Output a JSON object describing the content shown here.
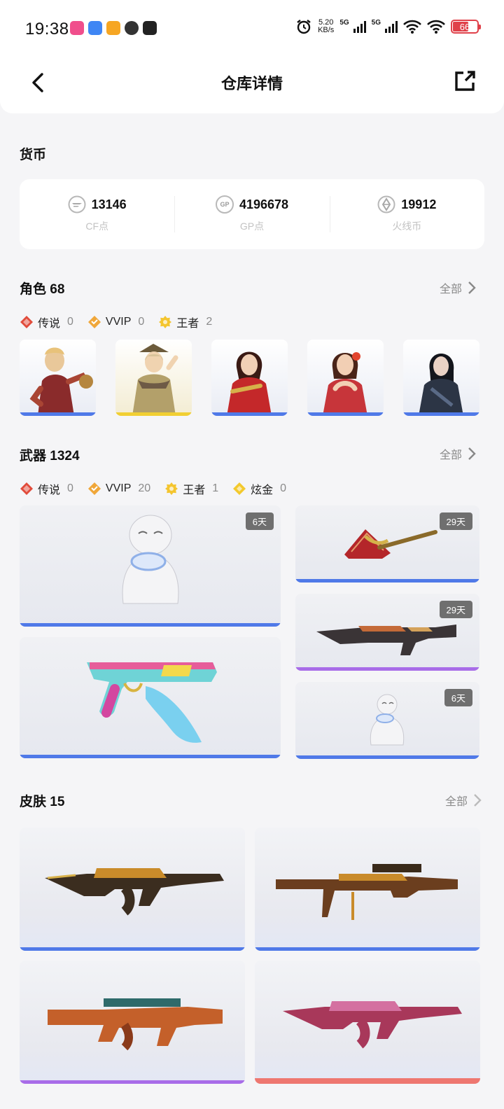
{
  "status": {
    "time": "19:38",
    "speed_value": "5.20",
    "speed_unit": "KB/s",
    "net1": "5G",
    "net2": "5G",
    "battery": "66"
  },
  "nav": {
    "title": "仓库详情"
  },
  "currency": {
    "title": "货币",
    "items": [
      {
        "value": "13146",
        "label": "CF点",
        "icon": "cf-icon"
      },
      {
        "value": "4196678",
        "label": "GP点",
        "icon": "GP"
      },
      {
        "value": "19912",
        "label": "火线币",
        "icon": "coin-icon"
      }
    ]
  },
  "roles": {
    "title": "角色 68",
    "all": "全部",
    "filters": [
      {
        "name": "传说",
        "count": "0"
      },
      {
        "name": "VVIP",
        "count": "0"
      },
      {
        "name": "王者",
        "count": "2"
      }
    ]
  },
  "weapons": {
    "title": "武器 1324",
    "all": "全部",
    "filters": [
      {
        "name": "传说",
        "count": "0"
      },
      {
        "name": "VVIP",
        "count": "20"
      },
      {
        "name": "王者",
        "count": "1"
      },
      {
        "name": "炫金",
        "count": "0"
      }
    ],
    "badges": [
      "6天",
      "29天",
      "29天",
      "6天"
    ]
  },
  "skins": {
    "title": "皮肤 15",
    "all": "全部"
  },
  "colors": {
    "legend": "#e14b3b",
    "vvip": "#f0a73a",
    "king": "#f4c52f",
    "gold": "#f3c92d",
    "blue_bar": "#4f79e8",
    "purple_bar": "#a86ce8"
  }
}
